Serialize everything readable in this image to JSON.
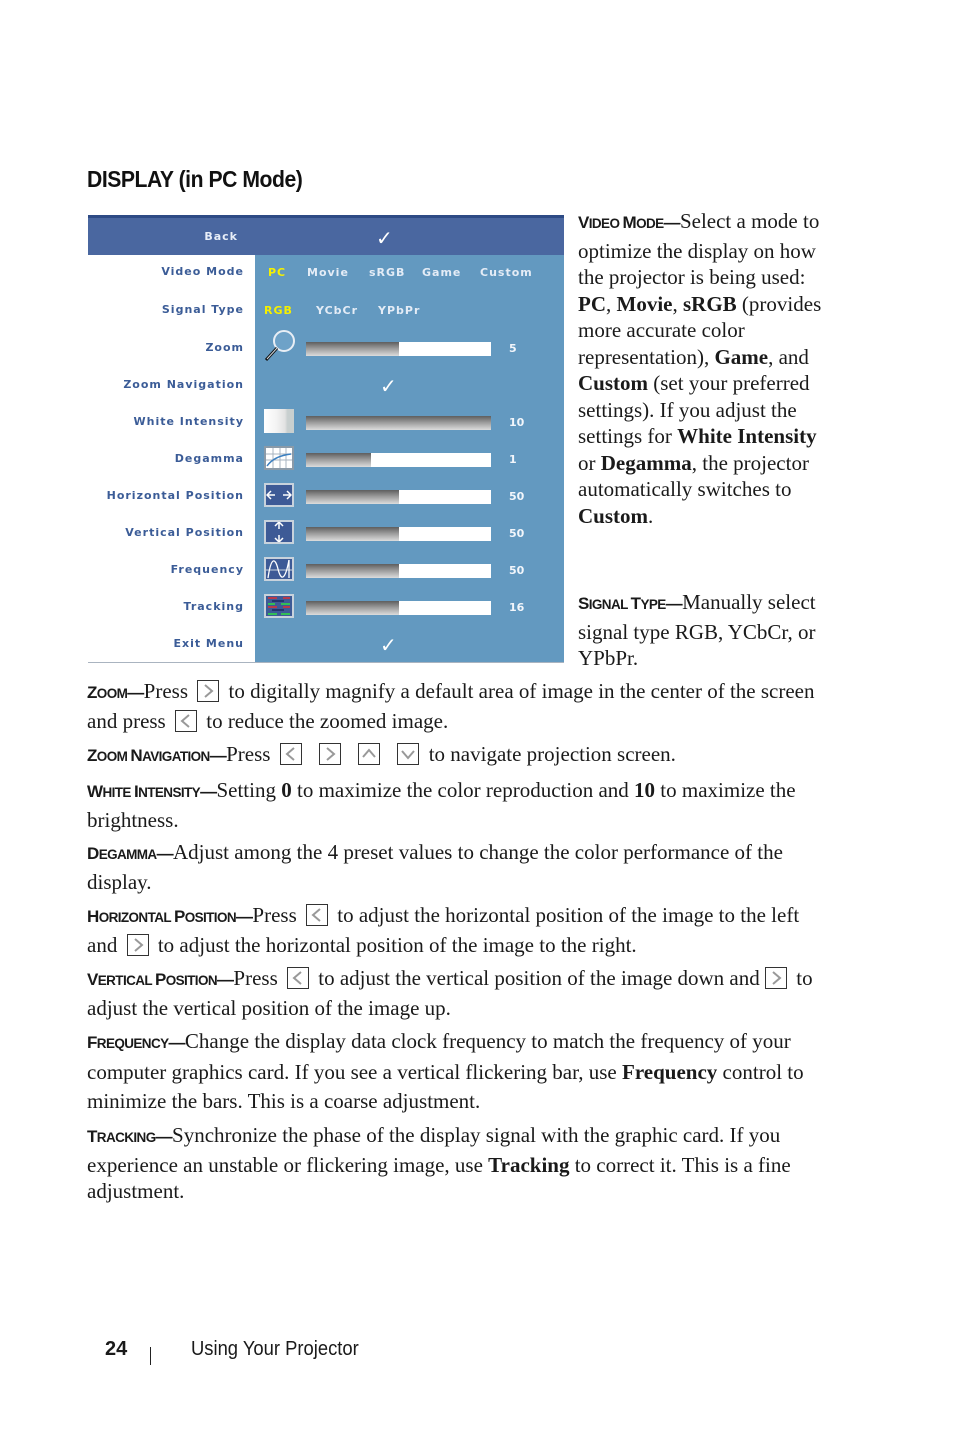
{
  "section_title": "DISPLAY (in PC Mode)",
  "osd": {
    "header": {
      "label": "Back",
      "check": "✓"
    },
    "rows": [
      {
        "label": "Video Mode",
        "options": [
          "PC",
          "Movie",
          "sRGB",
          "Game",
          "Custom"
        ],
        "selected": "PC"
      },
      {
        "label": "Signal Type",
        "options": [
          "RGB",
          "YCbCr",
          "YPbPr"
        ],
        "selected": "RGB"
      },
      {
        "label": "Zoom",
        "icon": "magnifier-icon",
        "value": "5",
        "fill_fraction": 0.5
      },
      {
        "label": "Zoom Navigation",
        "check": "✓"
      },
      {
        "label": "White Intensity",
        "icon": "white-intensity-icon",
        "value": "10",
        "fill_fraction": 1.0
      },
      {
        "label": "Degamma",
        "icon": "degamma-curve-icon",
        "value": "1",
        "fill_fraction": 0.35
      },
      {
        "label": "Horizontal Position",
        "icon": "horizontal-arrows-icon",
        "value": "50",
        "fill_fraction": 0.5
      },
      {
        "label": "Vertical Position",
        "icon": "vertical-arrows-icon",
        "value": "50",
        "fill_fraction": 0.5
      },
      {
        "label": "Frequency",
        "icon": "frequency-wave-icon",
        "value": "50",
        "fill_fraction": 0.5
      },
      {
        "label": "Tracking",
        "icon": "tracking-lines-icon",
        "value": "16",
        "fill_fraction": 0.5
      },
      {
        "label": "Exit Menu",
        "check": "✓"
      }
    ],
    "colors": {
      "header": "#4a67a0",
      "panel": "#6399c0",
      "label": "#3b5c97",
      "selected": "#f5f000"
    }
  },
  "video_mode": {
    "term_cap1": "V",
    "term_rest1": "IDEO ",
    "term_cap2": "M",
    "term_rest2": "ODE",
    "dash": "—",
    "t1": "Select a mode to optimize the display on how the projector is being used: ",
    "b1": "PC",
    "t2": ", ",
    "b2": "Movie",
    "t3": ", ",
    "b3": "sRGB",
    "t4": " (provides more accurate color representation), ",
    "b4": "Game",
    "t5": ", and ",
    "b5": "Custom",
    "t6": " (set your preferred settings). If you adjust the settings for ",
    "b6": "White Intensity",
    "t7": " or ",
    "b7": "Degamma",
    "t8": ", the projector automatically switches to ",
    "b8": "Custom",
    "t9": "."
  },
  "signal_type": {
    "term_cap1": "S",
    "term_rest1": "IGNAL ",
    "term_cap2": "T",
    "term_rest2": "YPE",
    "dash": "—",
    "text": "Manually select signal type RGB, YCbCr, or YPbPr."
  },
  "zoom": {
    "term_cap1": "Z",
    "term_rest1": "OOM",
    "dash": "—",
    "t1": "Press",
    "t2": "to digitally magnify a default area of image in the center of the screen and press",
    "t3": "to reduce the zoomed image."
  },
  "zoom_navigation": {
    "term_cap1": "Z",
    "term_rest1": "OOM ",
    "term_cap2": "N",
    "term_rest2": "AVIGATION",
    "dash": "—",
    "t1": "Press",
    "t2": "to navigate projection screen."
  },
  "white_intensity": {
    "term_cap1": "W",
    "term_rest1": "HITE ",
    "term_cap2": "I",
    "term_rest2": "NTENSITY",
    "dash": "—",
    "t1": "Setting ",
    "b1": "0",
    "t2": " to maximize the color reproduction and ",
    "b2": "10",
    "t3": " to maximize the brightness."
  },
  "degamma": {
    "term_cap1": "D",
    "term_rest1": "EGAMMA",
    "dash": "—",
    "text": "Adjust among the 4 preset values to change the color performance of the display."
  },
  "horizontal_position": {
    "term_cap1": "H",
    "term_rest1": "ORIZONTAL ",
    "term_cap2": "P",
    "term_rest2": "OSITION",
    "dash": "—",
    "t1": "Press",
    "t2": "to adjust the horizontal position of the image to the left and",
    "t3": "to adjust the horizontal position of the image to the right."
  },
  "vertical_position": {
    "term_cap1": "V",
    "term_rest1": "ERTICAL ",
    "term_cap2": "P",
    "term_rest2": "OSITION",
    "dash": "—",
    "t1": "Press",
    "t2": "to adjust the vertical position of the image down and",
    "t3": "to adjust the vertical position of the image up."
  },
  "frequency": {
    "term_cap1": "F",
    "term_rest1": "REQUENCY",
    "dash": "—",
    "t1": "Change the display data clock frequency to match the frequency of your computer graphics card. If you see a vertical flickering bar, use ",
    "b1": "Frequency",
    "t2": " control to minimize the bars. This is a coarse adjustment."
  },
  "tracking": {
    "term_cap1": "T",
    "term_rest1": "RACKING",
    "dash": "—",
    "t1": "Synchronize the phase of the display signal with the graphic card. If you experience an unstable or flickering image, use ",
    "b1": "Tracking",
    "t2": " to correct it. This is a fine adjustment."
  },
  "footer": {
    "page_number": "24",
    "chapter": "Using Your Projector"
  }
}
